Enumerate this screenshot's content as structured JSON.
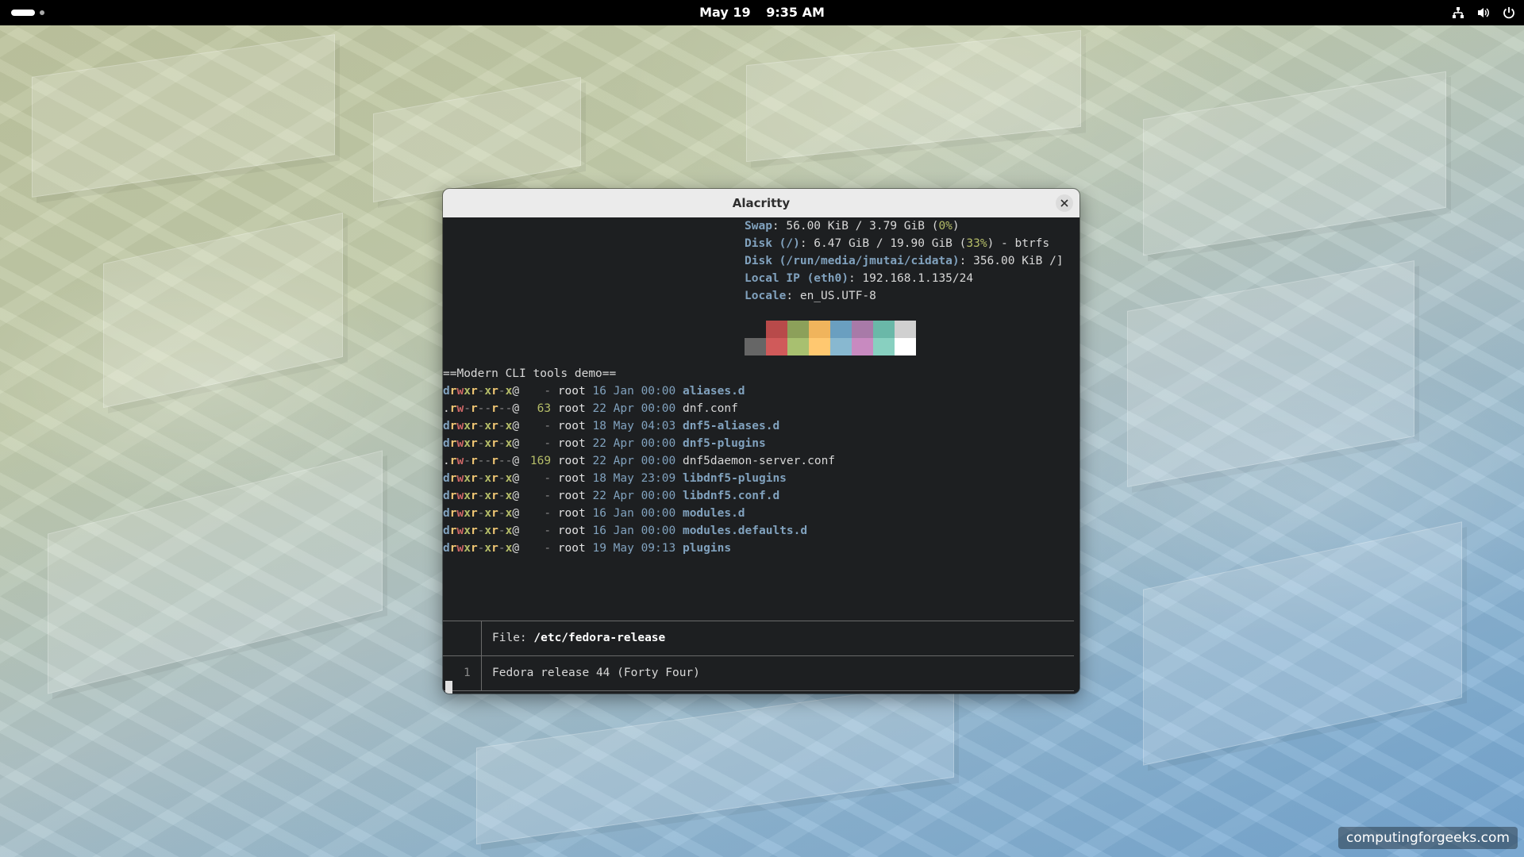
{
  "topbar": {
    "date": "May 19",
    "time": "9:35 AM"
  },
  "window": {
    "title": "Alacritty"
  },
  "terminal": {
    "sysinfo": [
      {
        "key": "Swap",
        "parts": [
          ": 56.00 KiB / 3.79 GiB (",
          "0%",
          ")"
        ]
      },
      {
        "key": "Disk (/)",
        "parts": [
          ": 6.47 GiB / 19.90 GiB (",
          "33%",
          ") - btrfs"
        ]
      },
      {
        "key": "Disk (/run/media/jmutai/cidata)",
        "parts": [
          ": 356.00 KiB /]",
          "",
          ""
        ]
      },
      {
        "key": "Local IP (eth0)",
        "parts": [
          ": 192.168.1.135/24",
          "",
          ""
        ]
      },
      {
        "key": "Locale",
        "parts": [
          ": en_US.UTF-8",
          "",
          ""
        ]
      }
    ],
    "palette_top": [
      "#1d1f21",
      "#b84a4a",
      "#8ca05a",
      "#f0b45c",
      "#6a9fc0",
      "#a87aa8",
      "#6ab8a8",
      "#d0d0d0"
    ],
    "palette_bottom": [
      "#666666",
      "#d05a5a",
      "#a8c070",
      "#ffc870",
      "#88b8d0",
      "#c88ac0",
      "#88d0c0",
      "#ffffff"
    ],
    "heading": "==Modern CLI tools demo==",
    "listing": [
      {
        "perm": "drwxr-xr-x@",
        "size": "-",
        "user": "root",
        "date": "16 Jan 00:00",
        "name": "aliases.d",
        "is_dir": true
      },
      {
        "perm": ".rw-r--r--@",
        "size": "63",
        "user": "root",
        "date": "22 Apr 00:00",
        "name": "dnf.conf",
        "is_dir": false
      },
      {
        "perm": "drwxr-xr-x@",
        "size": "-",
        "user": "root",
        "date": "18 May 04:03",
        "name": "dnf5-aliases.d",
        "is_dir": true
      },
      {
        "perm": "drwxr-xr-x@",
        "size": "-",
        "user": "root",
        "date": "22 Apr 00:00",
        "name": "dnf5-plugins",
        "is_dir": true
      },
      {
        "perm": ".rw-r--r--@",
        "size": "169",
        "user": "root",
        "date": "22 Apr 00:00",
        "name": "dnf5daemon-server.conf",
        "is_dir": false
      },
      {
        "perm": "drwxr-xr-x@",
        "size": "-",
        "user": "root",
        "date": "18 May 23:09",
        "name": "libdnf5-plugins",
        "is_dir": true
      },
      {
        "perm": "drwxr-xr-x@",
        "size": "-",
        "user": "root",
        "date": "22 Apr 00:00",
        "name": "libdnf5.conf.d",
        "is_dir": true
      },
      {
        "perm": "drwxr-xr-x@",
        "size": "-",
        "user": "root",
        "date": "16 Jan 00:00",
        "name": "modules.d",
        "is_dir": true
      },
      {
        "perm": "drwxr-xr-x@",
        "size": "-",
        "user": "root",
        "date": "16 Jan 00:00",
        "name": "modules.defaults.d",
        "is_dir": true
      },
      {
        "perm": "drwxr-xr-x@",
        "size": "-",
        "user": "root",
        "date": "19 May 09:13",
        "name": "plugins",
        "is_dir": true
      }
    ],
    "bat": {
      "file_label": "File: ",
      "file_path": "/etc/fedora-release",
      "line_number": "1",
      "line_content": "Fedora release 44 (Forty Four)"
    }
  },
  "watermark": "computingforgeeks.com"
}
